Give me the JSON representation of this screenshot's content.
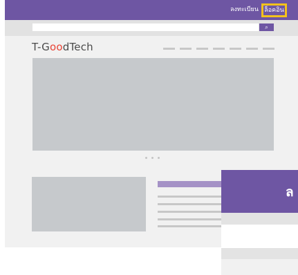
{
  "header": {
    "register_label": "ลงทะเบียน",
    "login_label": "ล็อคอิน"
  },
  "search": {
    "value": "",
    "button_icon": "search-icon"
  },
  "logo": {
    "prefix": "T-G",
    "o1": "o",
    "o2": "o",
    "suffix": "dTech"
  },
  "modal": {
    "title": "ล"
  },
  "colors": {
    "brand_purple": "#6e56a3",
    "highlight_yellow": "#f4c21b",
    "logo_accent_red": "#e94335"
  }
}
